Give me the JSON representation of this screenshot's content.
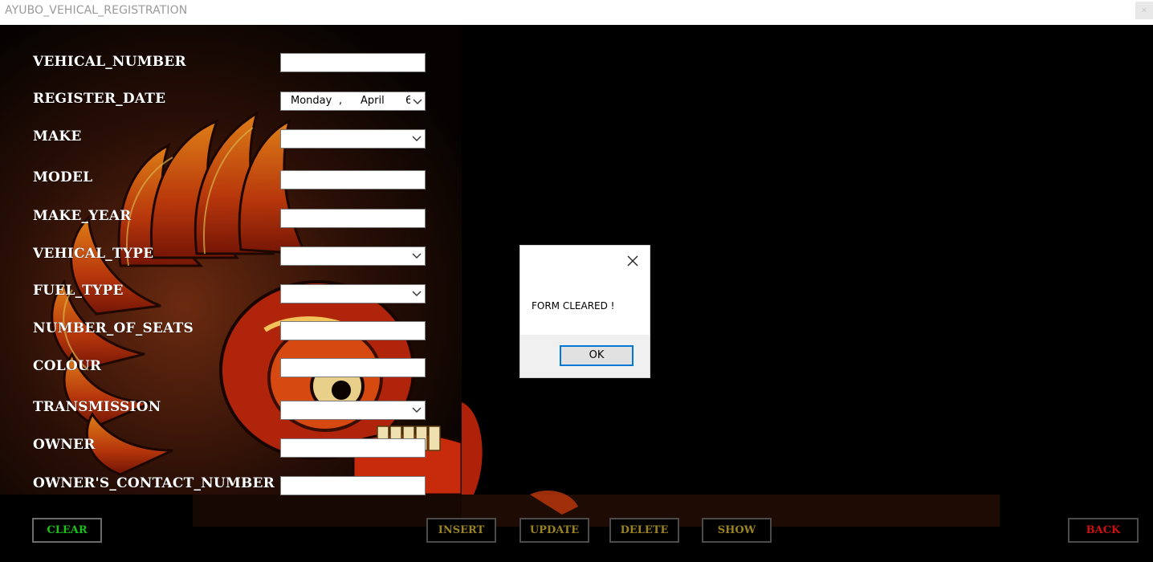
{
  "window": {
    "title": "AYUBO_VEHICAL_REGISTRATION",
    "close_glyph": "×"
  },
  "form": {
    "vehical_number": {
      "label": "VEHICAL_NUMBER",
      "value": ""
    },
    "register_date": {
      "label": "REGISTER_DATE",
      "day_name": "Monday",
      "separator": ",",
      "month": "April",
      "day_partial": "6"
    },
    "make": {
      "label": "MAKE",
      "value": ""
    },
    "model": {
      "label": "MODEL",
      "value": ""
    },
    "make_year": {
      "label": "MAKE_YEAR",
      "value": ""
    },
    "vehical_type": {
      "label": "VEHICAL_TYPE",
      "value": ""
    },
    "fuel_type": {
      "label": "FUEL_TYPE",
      "value": ""
    },
    "number_of_seats": {
      "label": "NUMBER_OF_SEATS",
      "value": ""
    },
    "colour": {
      "label": "COLOUR",
      "value": ""
    },
    "transmission": {
      "label": "TRANSMISSION",
      "value": ""
    },
    "owner": {
      "label": "OWNER",
      "value": ""
    },
    "owner_contact": {
      "label": "OWNER'S_CONTACT_NUMBER",
      "value": ""
    }
  },
  "buttons": {
    "clear": "CLEAR",
    "insert": "INSERT",
    "update": "UPDATE",
    "delete": "DELETE",
    "show": "SHOW",
    "back": "BACK"
  },
  "dialog": {
    "message": "FORM CLEARED !",
    "ok_label": "OK",
    "icon": "close-icon"
  },
  "colors": {
    "clear_text": "#19c219",
    "action_text": "#9a8420",
    "back_text": "#d01010",
    "ok_border": "#0078d7"
  }
}
